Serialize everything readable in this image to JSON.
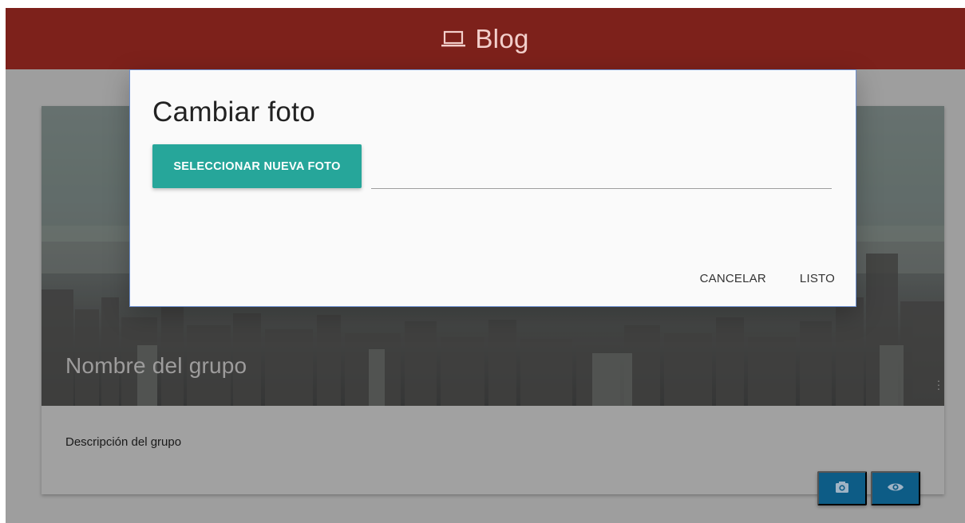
{
  "navbar": {
    "brand_icon": "laptop-icon",
    "brand_label": "Blog",
    "background": "#7d211b"
  },
  "card": {
    "title": "Nombre del grupo",
    "description": "Descripción del grupo",
    "actions": [
      {
        "icon": "camera-icon",
        "color": "#0d5c86"
      },
      {
        "icon": "eye-icon",
        "color": "#0d5c86"
      }
    ]
  },
  "modal": {
    "title": "Cambiar foto",
    "select_button_label": "SELECCIONAR NUEVA FOTO",
    "file_path_value": "",
    "cancel_label": "CANCELAR",
    "done_label": "LISTO",
    "accent": "#26a69a"
  }
}
